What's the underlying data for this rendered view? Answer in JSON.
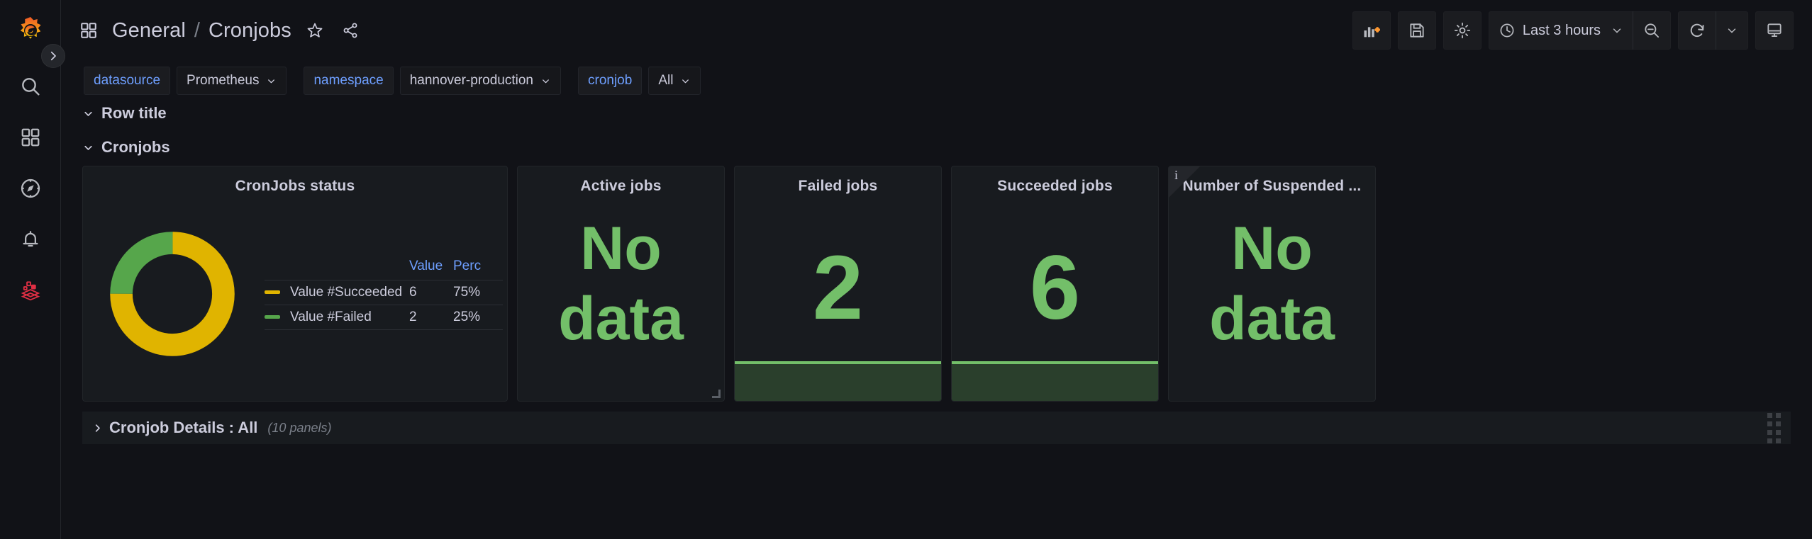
{
  "app": {
    "logo_icon": "grafana-logo-icon",
    "expand_toggle_icon": "chevron-right-icon"
  },
  "sidebar": {
    "items": [
      {
        "name": "search",
        "icon": "search-icon"
      },
      {
        "name": "dashboards",
        "icon": "dashboards-grid-icon"
      },
      {
        "name": "explore",
        "icon": "compass-icon"
      },
      {
        "name": "alerting",
        "icon": "bell-icon"
      },
      {
        "name": "connections",
        "icon": "layers-apps-icon"
      }
    ]
  },
  "header": {
    "dashboard_icon": "dashboard-grid-icon",
    "breadcrumb": {
      "folder": "General",
      "separator": "/",
      "dashboard": "Cronjobs"
    },
    "star_icon": "star-outline-icon",
    "share_icon": "share-nodes-icon"
  },
  "toolbar": {
    "add_panel": {
      "label": "",
      "icon": "add-panel-icon"
    },
    "save": {
      "label": "",
      "icon": "save-floppy-icon"
    },
    "settings": {
      "label": "",
      "icon": "gear-icon"
    },
    "time_picker": {
      "icon": "clock-icon",
      "value": "Last 3 hours",
      "chevron": "chevron-down-icon"
    },
    "zoom_out": {
      "icon": "zoom-out-icon"
    },
    "refresh": {
      "icon": "refresh-icon",
      "chevron": "chevron-down-icon"
    },
    "kiosk": {
      "icon": "tv-kiosk-icon"
    }
  },
  "variables": [
    {
      "label": "datasource",
      "value": "Prometheus",
      "has_value_box": true
    },
    {
      "label": "namespace",
      "value": "hannover-production",
      "has_value_box": true
    },
    {
      "label": "cronjob",
      "value": "All",
      "has_value_box": true
    }
  ],
  "rows": [
    {
      "title": "Row title",
      "collapsed": false,
      "chevron": "chevron-down-icon",
      "panel_count": ""
    },
    {
      "title": "Cronjobs",
      "collapsed": false,
      "chevron": "chevron-down-icon",
      "panel_count": ""
    },
    {
      "title": "Cronjob Details : All",
      "collapsed": true,
      "chevron": "chevron-right-icon",
      "panel_count": "(10 panels)"
    }
  ],
  "panels": {
    "cronjobs_status": {
      "title": "CronJobs status",
      "legend_headers": {
        "name": "",
        "value": "Value",
        "percent": "Perc"
      },
      "rows": [
        {
          "name": "Value #Succeeded",
          "value": "6",
          "percent": "75%",
          "color": "#e0b400"
        },
        {
          "name": "Value #Failed",
          "value": "2",
          "percent": "25%",
          "color": "#56a64b"
        }
      ]
    },
    "active_jobs": {
      "title": "Active jobs",
      "value": "No data"
    },
    "failed_jobs": {
      "title": "Failed jobs",
      "value": "2"
    },
    "succeeded_jobs": {
      "title": "Succeeded jobs",
      "value": "6"
    },
    "suspended": {
      "title": "Number of Suspended ...",
      "value": "No data",
      "info_icon": "info-i-icon"
    }
  },
  "colors": {
    "accent_blue": "#6e9fff",
    "green": "#73bf69",
    "yellow": "#e0b400",
    "panel_bg": "#181b1f",
    "page_bg": "#111217",
    "text": "#ccccdc"
  },
  "chart_data": {
    "type": "pie",
    "title": "CronJobs status",
    "labels": [
      "Value #Succeeded",
      "Value #Failed"
    ],
    "values": [
      6,
      2
    ],
    "percents": [
      75,
      25
    ],
    "colors": [
      "#e0b400",
      "#56a64b"
    ],
    "donut": true,
    "legend_position": "right",
    "legend_columns": [
      "Value",
      "Perc"
    ]
  }
}
